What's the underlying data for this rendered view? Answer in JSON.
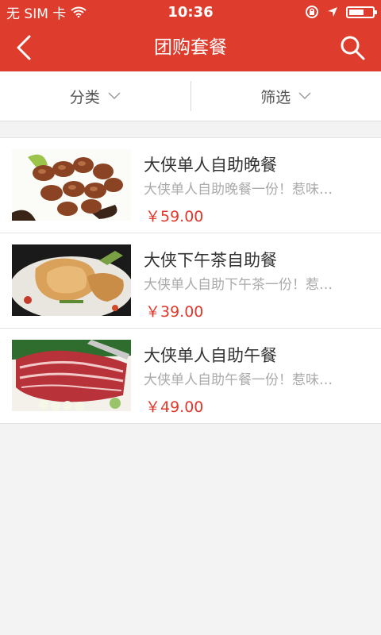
{
  "status_bar": {
    "carrier": "无 SIM 卡",
    "time": "10:36",
    "battery_level": 0.7
  },
  "nav": {
    "title": "团购套餐"
  },
  "filters": [
    {
      "label": "分类"
    },
    {
      "label": "筛选"
    }
  ],
  "items": [
    {
      "title": "大侠单人自助晚餐",
      "desc": "大侠单人自助晚餐一份！惹味…",
      "price": "￥59.00"
    },
    {
      "title": "大侠下午茶自助餐",
      "desc": "大侠单人自助下午茶一份！惹…",
      "price": "￥39.00"
    },
    {
      "title": "大侠单人自助午餐",
      "desc": "大侠单人自助午餐一份！惹味…",
      "price": "￥49.00"
    }
  ],
  "colors": {
    "brand": "#de3c2c",
    "price": "#e0382a",
    "background": "#f3f3f3"
  }
}
